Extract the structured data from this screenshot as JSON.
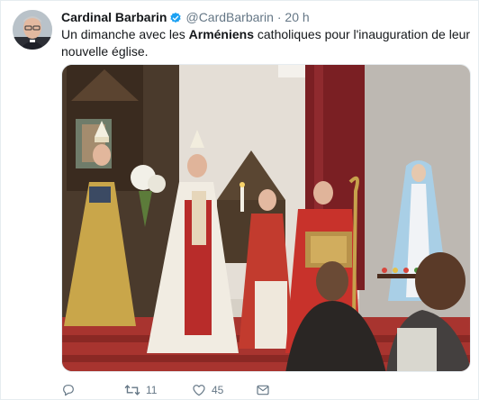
{
  "tweet": {
    "author_name": "Cardinal Barbarin",
    "author_handle": "@CardBarbarin",
    "separator": "·",
    "timestamp": "20 h",
    "text_before": "Un dimanche avec les ",
    "text_bold": "Arméniens",
    "text_after": " catholiques pour l'inauguration de leur nouvelle église."
  },
  "actions": {
    "reply_count": "",
    "retweet_count": "11",
    "like_count": "45",
    "dm_count": ""
  },
  "icons": {
    "verified": "verified-badge-icon",
    "reply": "reply-icon",
    "retweet": "retweet-icon",
    "like": "heart-icon",
    "dm": "envelope-icon"
  },
  "colors": {
    "accent": "#1da1f2",
    "text": "#14171a",
    "muted": "#657786",
    "border": "#e6ecf0"
  }
}
